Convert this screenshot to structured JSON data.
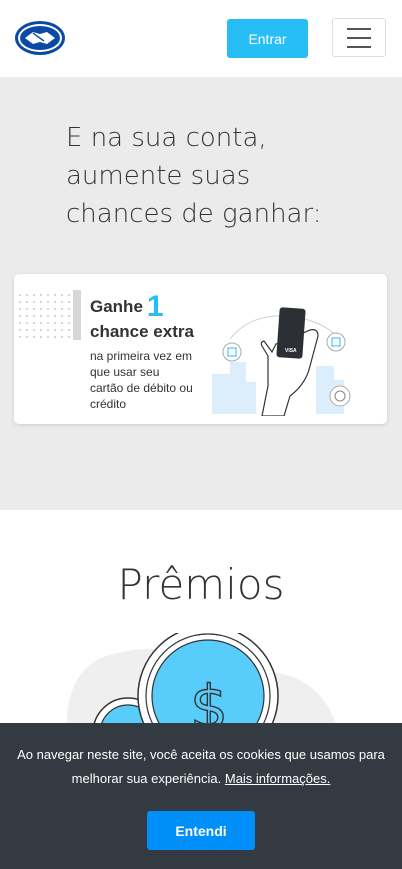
{
  "header": {
    "logo_alt": "Mercado Pago",
    "enter_label": "Entrar"
  },
  "hero": {
    "title_line1": "E na sua conta,",
    "title_line2": "aumente suas",
    "title_line3": "chances de ganhar:"
  },
  "promo": {
    "headline": "Ganhe",
    "number": "1",
    "subline": "chance extra",
    "desc_line1": "na primeira vez em",
    "desc_line2": "que usar seu",
    "desc_line3": "cartão de débito ou",
    "desc_line4": "crédito",
    "card_brand": "VISA"
  },
  "prizes": {
    "title": "Prêmios"
  },
  "cookie": {
    "text": "Ao navegar neste site, você aceita os cookies que usamos para melhorar sua experiência.",
    "link": "Mais informações.",
    "button": "Entendi"
  },
  "colors": {
    "accent": "#27bdf5",
    "banner": "#333a41",
    "button_primary": "#008ff9"
  }
}
